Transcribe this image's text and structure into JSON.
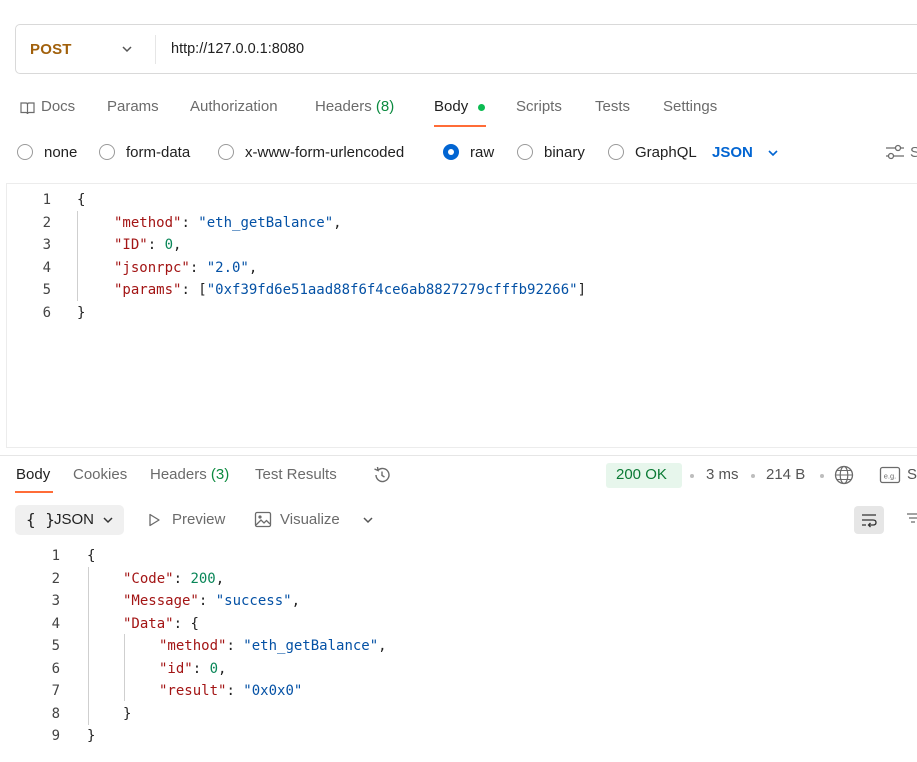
{
  "request": {
    "method": "POST",
    "url": "http://127.0.0.1:8080",
    "tabs": [
      {
        "label": "Docs"
      },
      {
        "label": "Params"
      },
      {
        "label": "Authorization"
      },
      {
        "label": "Headers",
        "count": "(8)"
      },
      {
        "label": "Body"
      },
      {
        "label": "Scripts"
      },
      {
        "label": "Tests"
      },
      {
        "label": "Settings"
      }
    ],
    "body_types": [
      "none",
      "form-data",
      "x-www-form-urlencoded",
      "raw",
      "binary",
      "GraphQL"
    ],
    "selected_body_type": "raw",
    "format": "JSON",
    "beautify_label": "S",
    "code_lines": [
      {
        "n": "1",
        "text": "{"
      },
      {
        "n": "2",
        "key": "\"method\"",
        "val": "\"eth_getBalance\"",
        "tail": ","
      },
      {
        "n": "3",
        "key": "\"ID\"",
        "num": "0",
        "tail": ","
      },
      {
        "n": "4",
        "key": "\"jsonrpc\"",
        "val": "\"2.0\"",
        "tail": ","
      },
      {
        "n": "5",
        "key": "\"params\"",
        "arr": "\"0xf39fd6e51aad88f6f4ce6ab8827279cfffb92266\""
      },
      {
        "n": "6",
        "text": "}"
      }
    ]
  },
  "response": {
    "tabs": [
      {
        "label": "Body"
      },
      {
        "label": "Cookies"
      },
      {
        "label": "Headers",
        "count": "(3)"
      },
      {
        "label": "Test Results"
      }
    ],
    "status": "200 OK",
    "time": "3 ms",
    "size": "214 B",
    "example_label": "S",
    "format": "JSON",
    "preview_label": "Preview",
    "visualize_label": "Visualize",
    "code_lines": [
      {
        "n": "1",
        "text": "{"
      },
      {
        "n": "2",
        "key": "\"Code\"",
        "num": "200",
        "tail": ","
      },
      {
        "n": "3",
        "key": "\"Message\"",
        "val": "\"success\"",
        "tail": ","
      },
      {
        "n": "4",
        "key": "\"Data\"",
        "open": "{"
      },
      {
        "n": "5",
        "key": "\"method\"",
        "val": "\"eth_getBalance\"",
        "tail": ","
      },
      {
        "n": "6",
        "key": "\"id\"",
        "num": "0",
        "tail": ","
      },
      {
        "n": "7",
        "key": "\"result\"",
        "val": "\"0x0x0\""
      },
      {
        "n": "8",
        "text": "}"
      },
      {
        "n": "9",
        "text": "}"
      }
    ]
  },
  "colors": {
    "method": "#a1600b",
    "accent_underline": "#ff6c37",
    "selected_radio": "#0265d2",
    "status_ok": "#0b7a35",
    "json_key": "#a31515",
    "json_string": "#0451a5",
    "json_number": "#098658"
  },
  "icons": [
    "chevron-down-icon",
    "docs-icon",
    "beautify-icon",
    "history-icon",
    "globe-icon",
    "example-icon",
    "preview-icon",
    "visualize-icon",
    "wrap-icon",
    "filter-icon"
  ]
}
